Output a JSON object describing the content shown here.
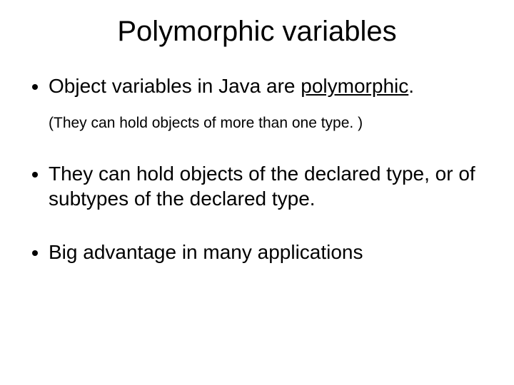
{
  "title": "Polymorphic variables",
  "bullets": {
    "b1_prefix": "Object variables in Java are ",
    "b1_underlined": "polymorphic",
    "b1_suffix": ".",
    "b1_note": "(They can hold objects of more than one type. )",
    "b2": "They can hold objects of the declared type, or of subtypes of the declared type.",
    "b3": "Big advantage in many applications"
  }
}
